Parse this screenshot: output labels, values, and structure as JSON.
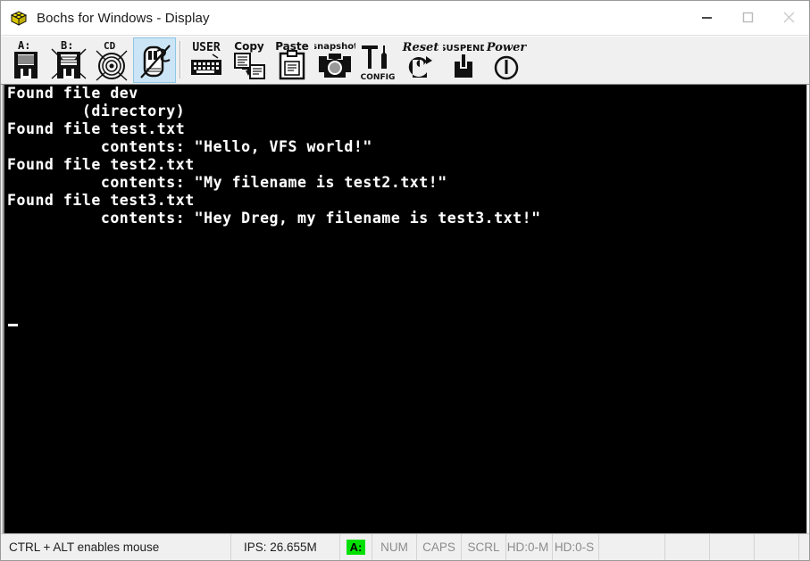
{
  "window": {
    "title": "Bochs for Windows - Display",
    "icon": "bochs-box-icon",
    "controls": {
      "minimize": "minimize-icon",
      "maximize": "maximize-icon",
      "close": "close-icon"
    }
  },
  "toolbar": {
    "buttons": [
      {
        "id": "floppy-a",
        "label": "A:",
        "icon": "floppy-disk-a-icon",
        "selected": false
      },
      {
        "id": "floppy-b",
        "label": "B:",
        "icon": "floppy-disk-b-icon",
        "selected": false
      },
      {
        "id": "cdrom",
        "label": "CD",
        "icon": "cdrom-icon",
        "selected": false
      },
      {
        "id": "mouse",
        "label": "",
        "icon": "mouse-disabled-icon",
        "selected": true
      },
      {
        "id": "user",
        "label": "USER",
        "icon": "keyboard-icon",
        "selected": false
      },
      {
        "id": "copy",
        "label": "Copy",
        "icon": "copy-icon",
        "selected": false
      },
      {
        "id": "paste",
        "label": "Paste",
        "icon": "paste-icon",
        "selected": false
      },
      {
        "id": "snapshot",
        "label": "snapshot",
        "icon": "camera-icon",
        "selected": false
      },
      {
        "id": "config",
        "label": "CONFIG",
        "icon": "tools-icon",
        "selected": false
      },
      {
        "id": "reset",
        "label": "Reset",
        "icon": "reset-arrow-icon",
        "selected": false
      },
      {
        "id": "suspend",
        "label": "SUSPEND",
        "icon": "suspend-icon",
        "selected": false
      },
      {
        "id": "power",
        "label": "Power",
        "icon": "power-icon",
        "selected": false
      }
    ]
  },
  "display": {
    "console_text": "Found file dev\n        (directory)\nFound file test.txt\n          contents: \"Hello, VFS world!\"\nFound file test2.txt\n          contents: \"My filename is test2.txt!\"\nFound file test3.txt\n          contents: \"Hey Dreg, my filename is test3.txt!\"",
    "cursor": "_",
    "background_color": "#000000",
    "foreground_color": "#ffffff"
  },
  "statusbar": {
    "message": "CTRL + ALT enables mouse",
    "ips": "IPS: 26.655M",
    "drive_led": "A:",
    "drive_led_color": "#00e000",
    "indicators": [
      "NUM",
      "CAPS",
      "SCRL"
    ],
    "disks": [
      "HD:0-M",
      "HD:0-S"
    ]
  }
}
